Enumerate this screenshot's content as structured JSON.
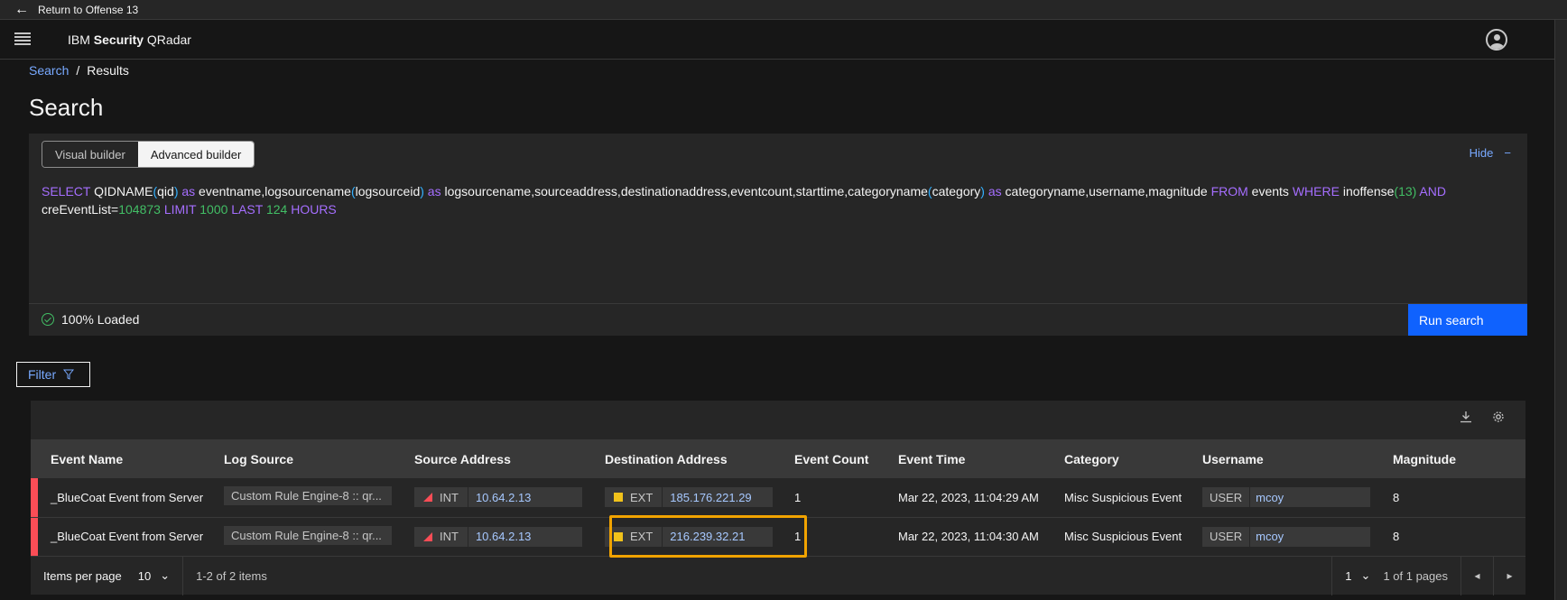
{
  "topbar": {
    "return_label": "Return to Offense 13"
  },
  "header": {
    "brand_prefix": "IBM ",
    "brand_bold": "Security",
    "brand_suffix": " QRadar"
  },
  "breadcrumb": {
    "search": "Search",
    "separator": "/",
    "current": "Results"
  },
  "page": {
    "title": "Search"
  },
  "builder": {
    "visual": "Visual builder",
    "advanced": "Advanced builder",
    "hide": "Hide",
    "hide_icon": "−"
  },
  "query": {
    "t1": "SELECT",
    "t2": " QIDNAME",
    "t3": "(",
    "t4": "qid",
    "t5": ")",
    "t6": " as",
    "t7": " eventname,logsourcename",
    "t8": "(",
    "t9": "logsourceid",
    "t10": ")",
    "t11": " as",
    "t12": " logsourcename,sourceaddress,destinationaddress,eventcount,starttime,categoryname",
    "t13": "(",
    "t14": "category",
    "t15": ")",
    "t16": " as",
    "t17": " categoryname,username,magnitude ",
    "t18": "FROM",
    "t19": " events ",
    "t20": "WHERE",
    "t21": " inoffense",
    "t22": "(13)",
    "t23": " AND",
    "t24": " creEventList=",
    "t25": "104873",
    "t26": " LIMIT",
    "t27": " 1000",
    "t28": " LAST",
    "t29": " 124",
    "t30": " HOURS"
  },
  "status": {
    "loaded": "100% Loaded"
  },
  "actions": {
    "run": "Run search",
    "filter": "Filter"
  },
  "table": {
    "headers": [
      "Event Name",
      "Log Source",
      "Source Address",
      "Destination Address",
      "Event Count",
      "Event Time",
      "Category",
      "Username",
      "Magnitude"
    ],
    "rows": [
      {
        "event_name": "_BlueCoat Event from Server",
        "log_source": "Custom Rule Engine-8 :: qr...",
        "src_tag": "INT",
        "src": "10.64.2.13",
        "dst_tag": "EXT",
        "dst": "185.176.221.29",
        "count": "1",
        "time": "Mar 22, 2023, 11:04:29 AM",
        "category": "Misc Suspicious Event",
        "user_tag": "USER",
        "user": "mcoy",
        "magnitude": "8"
      },
      {
        "event_name": "_BlueCoat Event from Server",
        "log_source": "Custom Rule Engine-8 :: qr...",
        "src_tag": "INT",
        "src": "10.64.2.13",
        "dst_tag": "EXT",
        "dst": "216.239.32.21",
        "count": "1",
        "time": "Mar 22, 2023, 11:04:30 AM",
        "category": "Misc Suspicious Event",
        "user_tag": "USER",
        "user": "mcoy",
        "magnitude": "8"
      }
    ]
  },
  "pagination": {
    "items_per_page_label": "Items per page",
    "items_per_page": "10",
    "range": "1-2 of 2 items",
    "page": "1",
    "of_pages": "1 of 1 pages"
  },
  "colors": {
    "accent": "#0f62fe",
    "severity": "#fa4d56",
    "external": "#f1c21b",
    "highlight": "#f1a300",
    "return_bar": "#8a3ffc"
  }
}
